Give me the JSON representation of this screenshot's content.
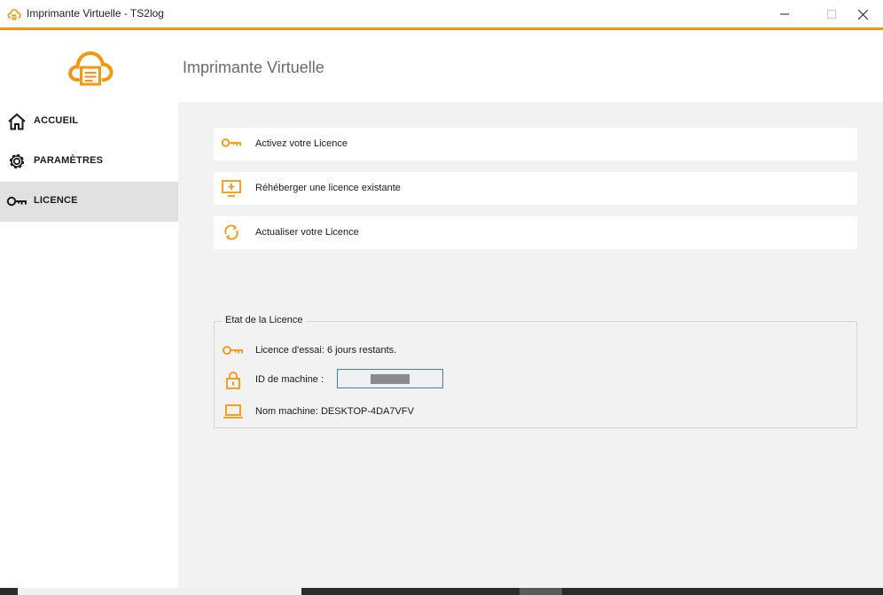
{
  "window": {
    "title": "Imprimante Virtuelle - TS2log"
  },
  "header": {
    "title": "Imprimante Virtuelle"
  },
  "sidebar": {
    "items": [
      {
        "label": "ACCUEIL",
        "icon": "home-icon",
        "active": false
      },
      {
        "label": "PARAMÈTRES",
        "icon": "gear-icon",
        "active": false
      },
      {
        "label": "LICENCE",
        "icon": "key-icon",
        "active": true
      }
    ]
  },
  "actions": [
    {
      "label": "Activez votre Licence",
      "icon": "key-icon"
    },
    {
      "label": "Réhéberger une licence existante",
      "icon": "monitor-plus-icon"
    },
    {
      "label": "Actualiser votre Licence",
      "icon": "refresh-icon"
    }
  ],
  "status": {
    "legend": "Etat de la Licence",
    "trial": "Licence d'essai: 6 jours restants.",
    "machine_id_label": "ID de machine :",
    "machine_name": "Nom machine: DESKTOP-4DA7VFV"
  },
  "colors": {
    "accent": "#f29711",
    "active_nav": "#e1e1e1",
    "content_bg": "#f2f2f2"
  }
}
